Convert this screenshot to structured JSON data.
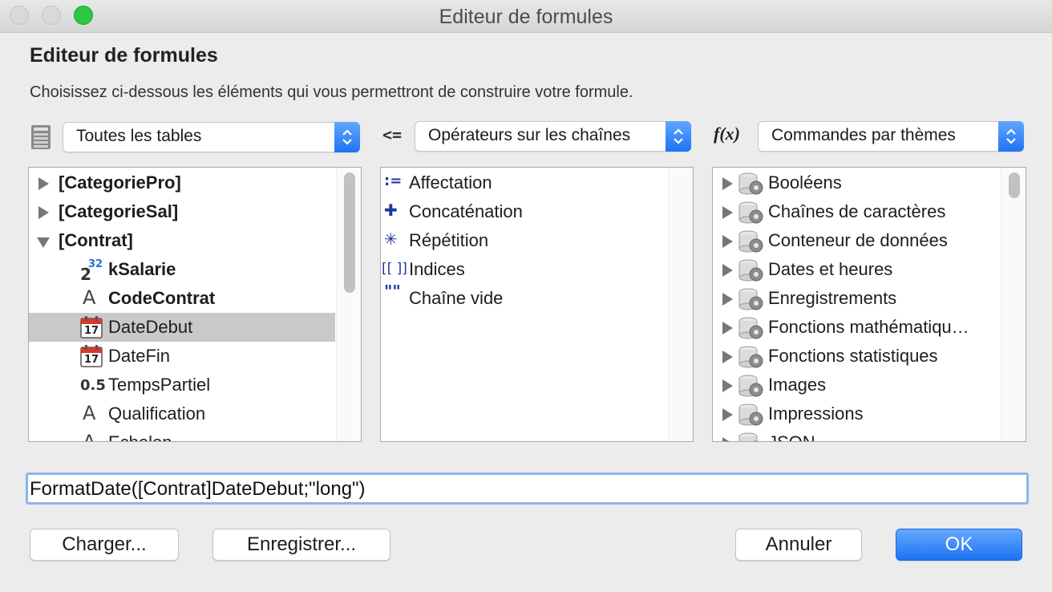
{
  "window": {
    "title": "Editeur de formules"
  },
  "dialog": {
    "heading": "Editeur de formules",
    "description": "Choisissez ci-dessous les éléments qui vous permettront de construire votre formule."
  },
  "tables_selector": {
    "value": "Toutes les tables",
    "icon": "table-icon"
  },
  "operators_selector": {
    "value": "Opérateurs sur les chaînes",
    "icon": "operator-icon",
    "icon_text": "<="
  },
  "commands_selector": {
    "value": "Commandes par thèmes",
    "icon": "function-icon",
    "icon_text": "f(x)"
  },
  "fields_list": {
    "items": [
      {
        "label": "[CategoriePro]",
        "kind": "table",
        "expanded": false
      },
      {
        "label": "[CategorieSal]",
        "kind": "table",
        "expanded": false
      },
      {
        "label": "[Contrat]",
        "kind": "table",
        "expanded": true
      },
      {
        "label": "kSalarie",
        "kind": "integer-field",
        "icon_text": "2",
        "icon_sup": "32"
      },
      {
        "label": "CodeContrat",
        "kind": "text-field",
        "icon_text": "A"
      },
      {
        "label": "DateDebut",
        "kind": "date-field",
        "icon_text": "17",
        "selected": true
      },
      {
        "label": "DateFin",
        "kind": "date-field",
        "icon_text": "17"
      },
      {
        "label": "TempsPartiel",
        "kind": "real-field",
        "icon_text": "0.5"
      },
      {
        "label": "Qualification",
        "kind": "text-field",
        "icon_text": "A"
      },
      {
        "label": "Echelon",
        "kind": "text-field",
        "icon_text": "A"
      }
    ]
  },
  "operators_list": {
    "items": [
      {
        "label": "Affectation",
        "icon": "assignment-icon",
        "icon_text": ":="
      },
      {
        "label": "Concaténation",
        "icon": "plus-icon",
        "icon_text": "✚"
      },
      {
        "label": "Répétition",
        "icon": "asterisk-icon",
        "icon_text": "✳"
      },
      {
        "label": "Indices",
        "icon": "brackets-icon",
        "icon_text": "[[ ]]"
      },
      {
        "label": "Chaîne vide",
        "icon": "empty-string-icon",
        "icon_text": "\"\""
      }
    ]
  },
  "commands_list": {
    "items": [
      {
        "label": "Booléens"
      },
      {
        "label": "Chaînes de caractères"
      },
      {
        "label": "Conteneur de données"
      },
      {
        "label": "Dates et heures"
      },
      {
        "label": "Enregistrements"
      },
      {
        "label": "Fonctions mathématiqu…"
      },
      {
        "label": "Fonctions statistiques"
      },
      {
        "label": "Images"
      },
      {
        "label": "Impressions"
      },
      {
        "label": "JSON"
      }
    ]
  },
  "formula": {
    "value": "FormatDate([Contrat]DateDebut;\"long\")"
  },
  "buttons": {
    "load": "Charger...",
    "save": "Enregistrer...",
    "cancel": "Annuler",
    "ok": "OK"
  },
  "colors": {
    "accent": "#1d74f2",
    "selection": "#c9c9c9",
    "operator_icon": "#1f3799"
  }
}
